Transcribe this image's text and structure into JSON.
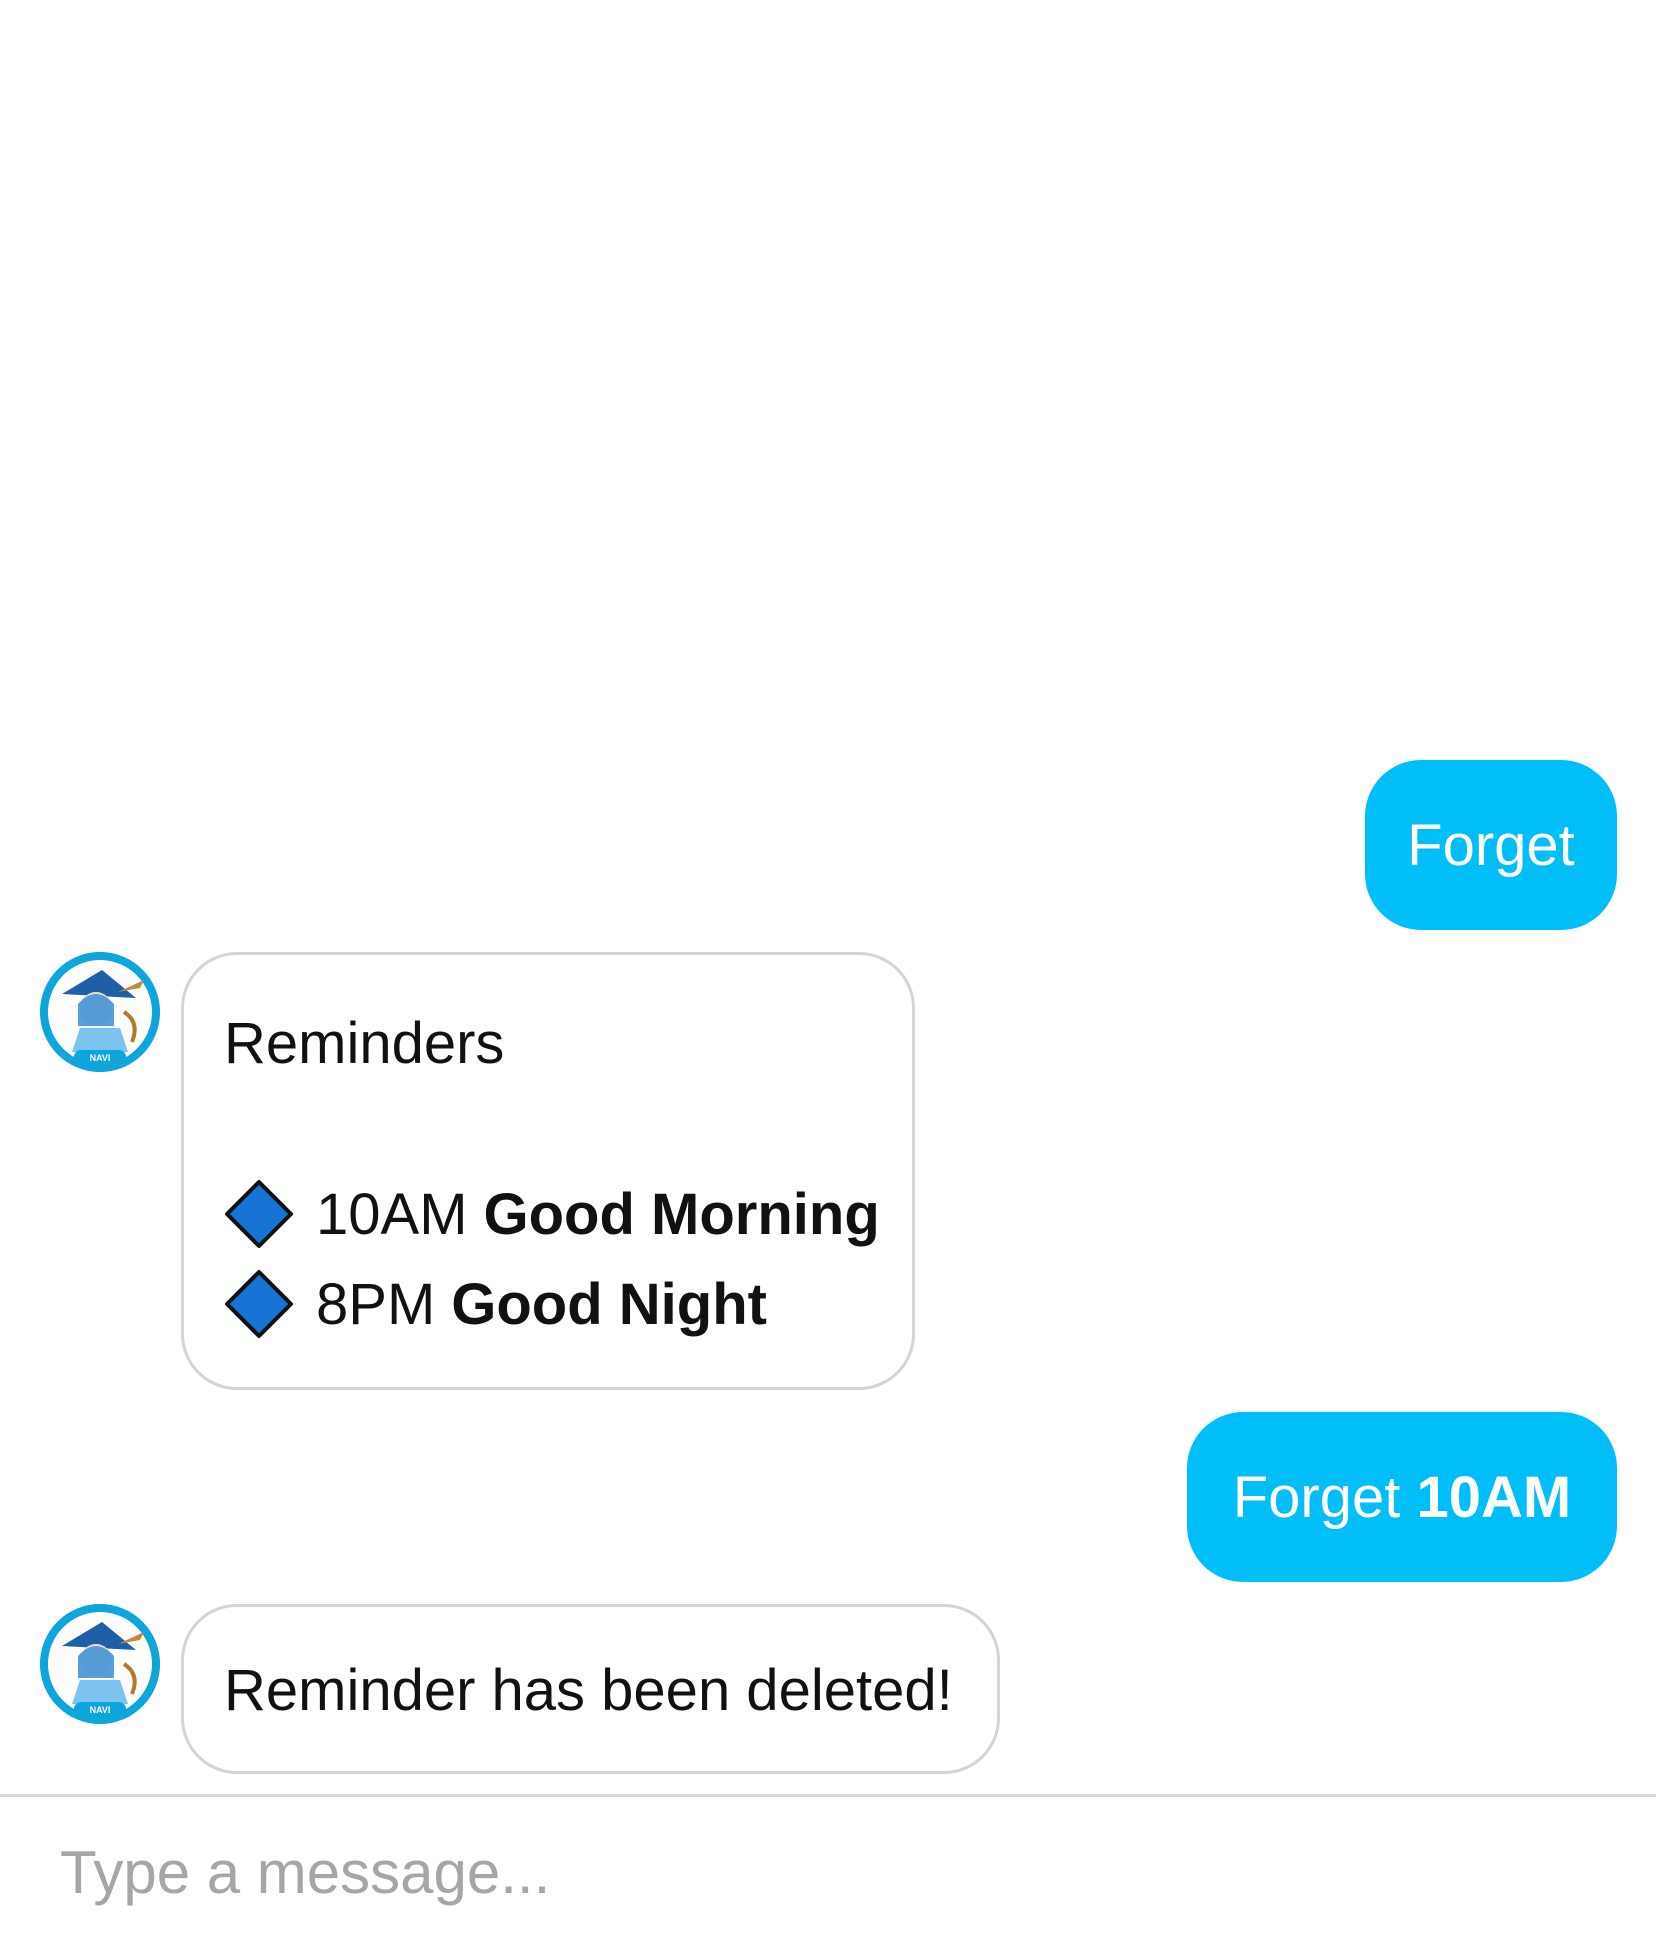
{
  "colors": {
    "user_bubble": "#00bff8",
    "bot_bubble_border": "#d4d4d4",
    "diamond_fill": "#1874d4"
  },
  "messages": [
    {
      "from": "user",
      "text": "Forget",
      "bold": ""
    },
    {
      "from": "bot",
      "avatar_label": "NAVI",
      "title": "Reminders",
      "items": [
        {
          "icon": "blue-diamond-icon",
          "time": "10AM",
          "name": "Good Morning"
        },
        {
          "icon": "blue-diamond-icon",
          "time": "8PM",
          "name": "Good Night"
        }
      ]
    },
    {
      "from": "user",
      "text": "Forget",
      "bold": "10AM"
    },
    {
      "from": "bot",
      "avatar_label": "NAVI",
      "text": "Reminder has been deleted!"
    }
  ],
  "composer": {
    "placeholder": "Type a message..."
  }
}
